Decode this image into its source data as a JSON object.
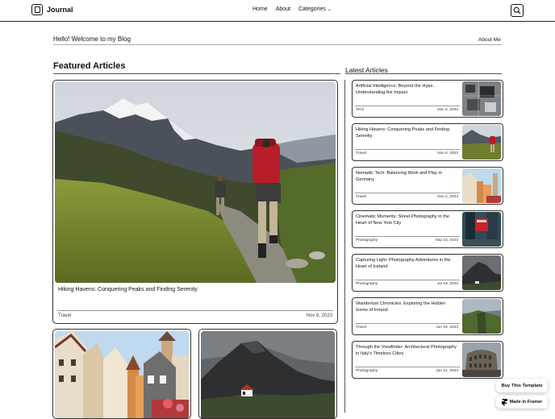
{
  "header": {
    "brand": "Journal",
    "nav": [
      "Home",
      "About",
      "Categories"
    ]
  },
  "welcome": {
    "text": "Hello! Welcome to my Blog",
    "about_link": "About Me"
  },
  "featured": {
    "section_title": "Featured Articles",
    "main": {
      "title": "Hiking Havens: Conquering Peaks and Finding Serenity",
      "category": "Travel",
      "date": "Nov 8, 2023"
    }
  },
  "latest": {
    "section_title": "Latest Articles",
    "items": [
      {
        "title": "Artificial Intelligence: Beyond the Hype, Understanding the Impact",
        "category": "Tech",
        "date": "Dec 6, 2023"
      },
      {
        "title": "Hiking Havens: Conquering Peaks and Finding Serenity",
        "category": "Travel",
        "date": "Nov 8, 2023"
      },
      {
        "title": "Nomadic Tech: Balancing Work and Play in Germany",
        "category": "Travel",
        "date": "Nov 2, 2023"
      },
      {
        "title": "Cinematic Moments: Street Photography in the Heart of New York City",
        "category": "Photography",
        "date": "Sep 15, 2023"
      },
      {
        "title": "Capturing Light: Photography Adventures in the Heart of Iceland",
        "category": "Photography",
        "date": "Jul 19, 2023"
      },
      {
        "title": "Wanderlust Chronicles: Exploring the Hidden Gems of Ireland",
        "category": "Travel",
        "date": "Jun 29, 2023"
      },
      {
        "title": "Through the Viewfinder: Architectural Photography in Italy's Timeless Cities",
        "category": "Photography",
        "date": "Jun 21, 2023"
      }
    ]
  },
  "badges": {
    "buy": "Buy This Template",
    "framer": "Made in Framer"
  }
}
